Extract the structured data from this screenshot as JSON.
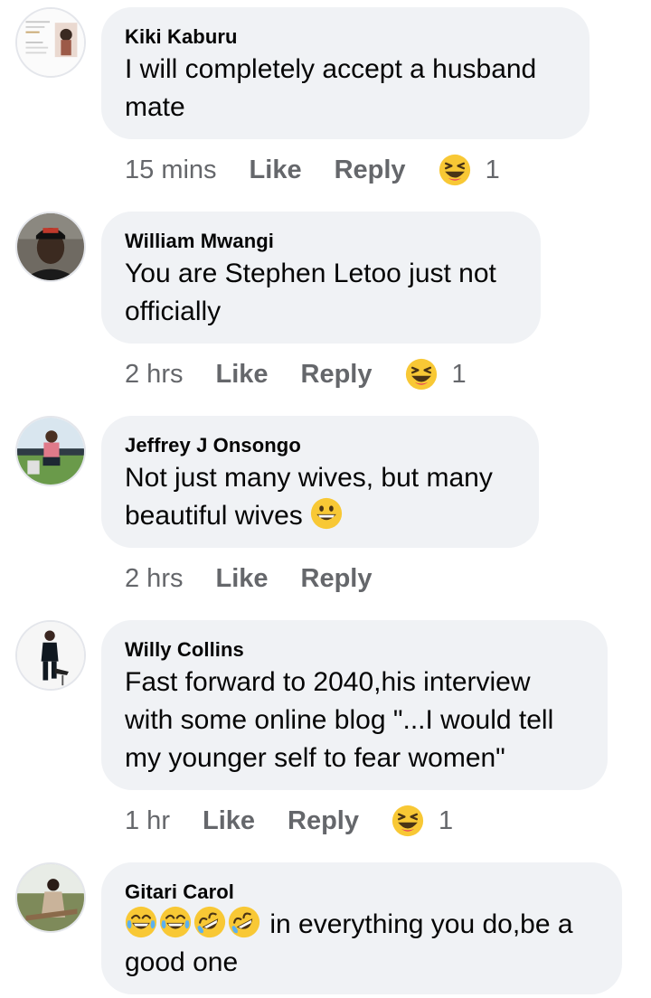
{
  "comments": [
    {
      "author": "Kiki Kaburu",
      "text": "I will completely accept a husband mate",
      "line1": "I will completely accept a husband",
      "line2": "mate",
      "time": "15 mins",
      "like_label": "Like",
      "reply_label": "Reply",
      "reaction": "laughing-squint-emoji",
      "reaction_count": "1"
    },
    {
      "author": "William Mwangi",
      "line1": "You are Stephen Letoo just not",
      "line2": "officially",
      "time": "2 hrs",
      "like_label": "Like",
      "reply_label": "Reply",
      "reaction": "laughing-squint-emoji",
      "reaction_count": "1"
    },
    {
      "author": "Jeffrey J Onsongo",
      "line1": "Not just many wives, but many",
      "line2": "beautiful wives",
      "line2_emoji": "grinning-face-emoji",
      "time": "2 hrs",
      "like_label": "Like",
      "reply_label": "Reply"
    },
    {
      "author": "Willy Collins",
      "line1": "Fast forward to 2040,his interview",
      "line2": "with some online blog \"...I would tell",
      "line3": "my younger self to fear women\"",
      "time": "1 hr",
      "like_label": "Like",
      "reply_label": "Reply",
      "reaction": "laughing-squint-emoji",
      "reaction_count": "1"
    },
    {
      "author": "Gitari Carol",
      "line1_emojis": [
        "tears-of-joy-emoji",
        "tears-of-joy-emoji",
        "rolling-laughing-emoji",
        "rolling-laughing-emoji"
      ],
      "line1": " in everything you do,be a",
      "line2": "good one"
    }
  ],
  "colors": {
    "bubble": "#f0f2f5",
    "meta_text": "#65676b",
    "name_text": "#050505",
    "emoji_yellow": "#f7c52d"
  }
}
